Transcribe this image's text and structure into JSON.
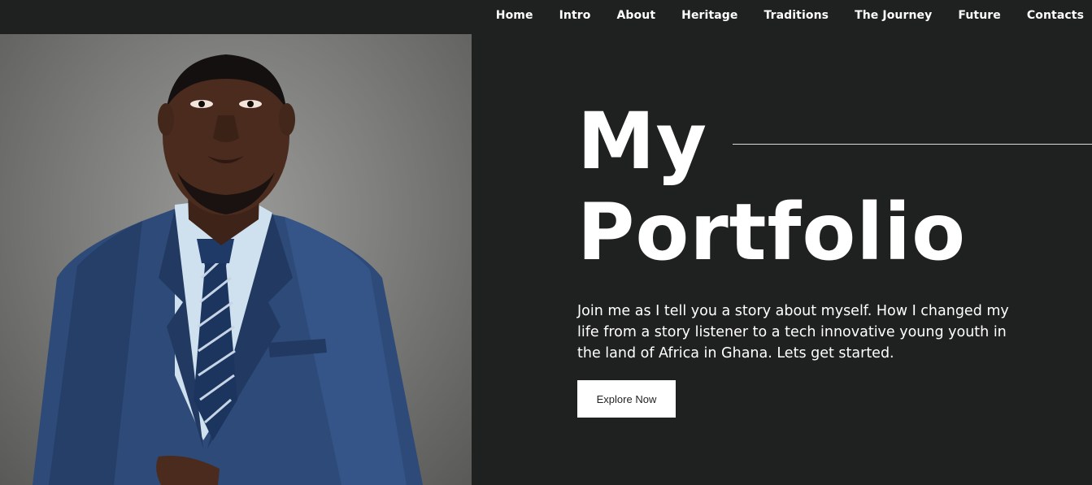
{
  "nav": {
    "items": [
      {
        "label": "Home"
      },
      {
        "label": "Intro"
      },
      {
        "label": "About"
      },
      {
        "label": "Heritage"
      },
      {
        "label": "Traditions"
      },
      {
        "label": "The Journey"
      },
      {
        "label": "Future"
      },
      {
        "label": "Contacts"
      }
    ]
  },
  "hero": {
    "title_line1": "My",
    "title_line2": "Portfolio",
    "description": "Join me as I tell you a story about myself. How I changed my life from a story listener to a tech innovative young youth in the land of Africa in Ghana. Lets get started.",
    "cta_label": "Explore Now"
  },
  "colors": {
    "background": "#1f2020",
    "text": "#ffffff",
    "button_bg": "#ffffff",
    "suit": "#2d4a78"
  }
}
